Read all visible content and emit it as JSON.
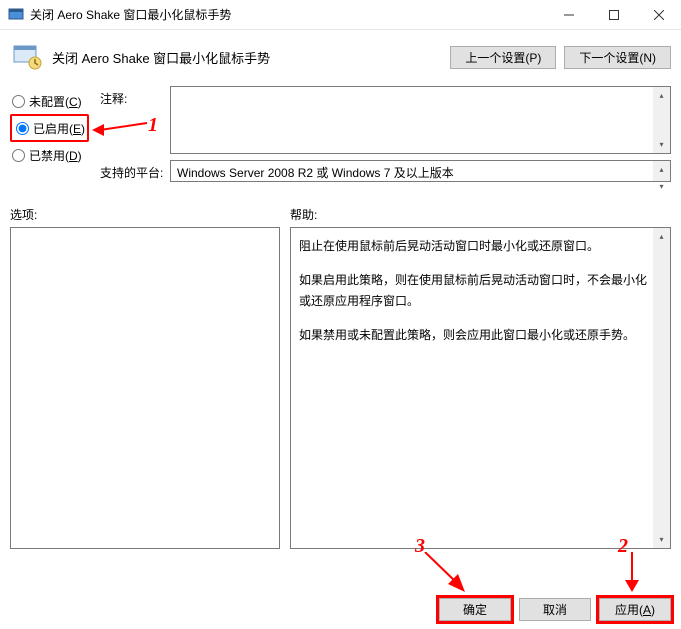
{
  "titlebar": {
    "title": "关闭 Aero Shake 窗口最小化鼠标手势"
  },
  "header": {
    "title": "关闭 Aero Shake 窗口最小化鼠标手势",
    "prev": "上一个设置(P)",
    "next": "下一个设置(N)"
  },
  "radios": {
    "not_configured": "未配置(C)",
    "enabled": "已启用(E)",
    "disabled": "已禁用(D)",
    "selected": "enabled"
  },
  "labels": {
    "comment": "注释:",
    "platforms": "支持的平台:",
    "options": "选项:",
    "help": "帮助:"
  },
  "platforms_text": "Windows Server 2008 R2 或 Windows 7 及以上版本",
  "help_paragraphs": [
    "阻止在使用鼠标前后晃动活动窗口时最小化或还原窗口。",
    "如果启用此策略，则在使用鼠标前后晃动活动窗口时，不会最小化或还原应用程序窗口。",
    "如果禁用或未配置此策略，则会应用此窗口最小化或还原手势。"
  ],
  "footer": {
    "ok": "确定",
    "cancel": "取消",
    "apply": "应用(A)"
  },
  "annotations": {
    "n1": "1",
    "n2": "2",
    "n3": "3"
  }
}
